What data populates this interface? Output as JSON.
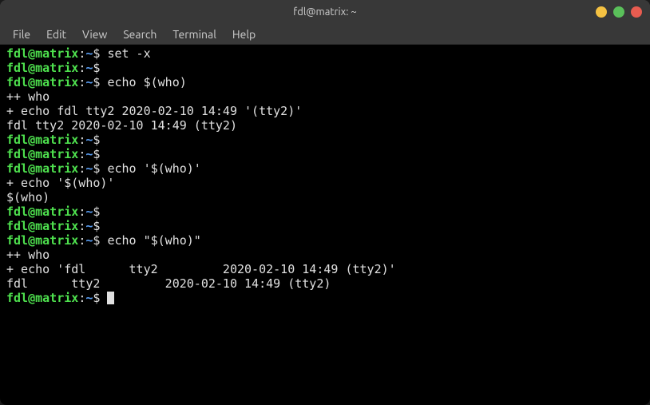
{
  "titlebar": {
    "title": "fdl@matrix: ~"
  },
  "menubar": {
    "items": [
      "File",
      "Edit",
      "View",
      "Search",
      "Terminal",
      "Help"
    ]
  },
  "prompt": {
    "userhost": "fdl@matrix",
    "colon": ":",
    "path": "~",
    "sigil": "$"
  },
  "session": [
    {
      "type": "prompt",
      "cmd": "set -x"
    },
    {
      "type": "prompt",
      "cmd": ""
    },
    {
      "type": "prompt",
      "cmd": "echo $(who)"
    },
    {
      "type": "output",
      "text": "++ who"
    },
    {
      "type": "output",
      "text": "+ echo fdl tty2 2020-02-10 14:49 '(tty2)'"
    },
    {
      "type": "output",
      "text": "fdl tty2 2020-02-10 14:49 (tty2)"
    },
    {
      "type": "prompt",
      "cmd": ""
    },
    {
      "type": "prompt",
      "cmd": ""
    },
    {
      "type": "prompt",
      "cmd": "echo '$(who)'"
    },
    {
      "type": "output",
      "text": "+ echo '$(who)'"
    },
    {
      "type": "output",
      "text": "$(who)"
    },
    {
      "type": "prompt",
      "cmd": ""
    },
    {
      "type": "prompt",
      "cmd": ""
    },
    {
      "type": "prompt",
      "cmd": "echo \"$(who)\""
    },
    {
      "type": "output",
      "text": "++ who"
    },
    {
      "type": "output",
      "text": "+ echo 'fdl      tty2         2020-02-10 14:49 (tty2)'"
    },
    {
      "type": "output",
      "text": "fdl      tty2         2020-02-10 14:49 (tty2)"
    },
    {
      "type": "prompt",
      "cmd": "",
      "cursor": true
    }
  ]
}
